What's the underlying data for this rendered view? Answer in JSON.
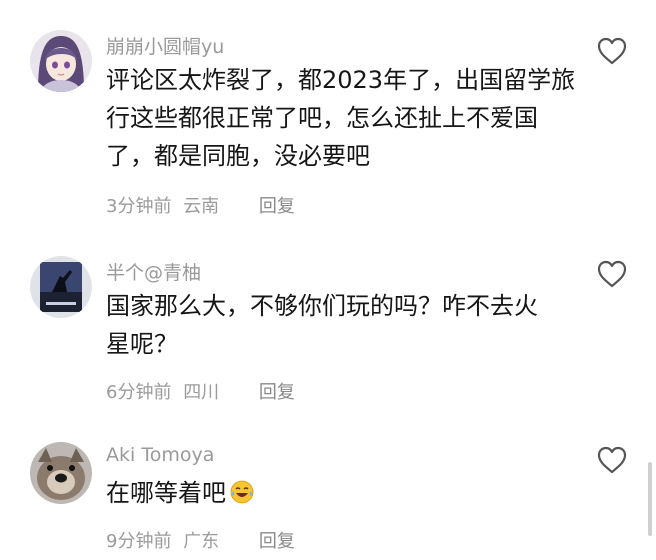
{
  "comments": [
    {
      "username": "崩崩小圆帽yu",
      "text": "评论区太炸裂了，都2023年了，出国留学旅行这些都很正常了吧，怎么还扯上不爱国了，都是同胞，没必要吧",
      "time": "3分钟前",
      "location": "云南",
      "reply": "回复",
      "avatar_icon": "anime-girl-avatar",
      "like_icon": "heart-outline-icon"
    },
    {
      "username": "半个@青柚",
      "text": "国家那么大，不够你们玩的吗？咋不去火星呢？",
      "time": "6分钟前",
      "location": "四川",
      "reply": "回复",
      "avatar_icon": "dark-poster-avatar",
      "like_icon": "heart-outline-icon"
    },
    {
      "username": "Aki Tomoya",
      "text": "在哪等着吧",
      "time": "9分钟前",
      "location": "广东",
      "reply": "回复",
      "avatar_icon": "dog-avatar",
      "like_icon": "heart-outline-icon",
      "emoji": "laughing-tears-emoji"
    }
  ],
  "colors": {
    "text": "#161616",
    "username": "#9a9a9a",
    "meta": "#9b9b9b",
    "icon": "#555555"
  }
}
